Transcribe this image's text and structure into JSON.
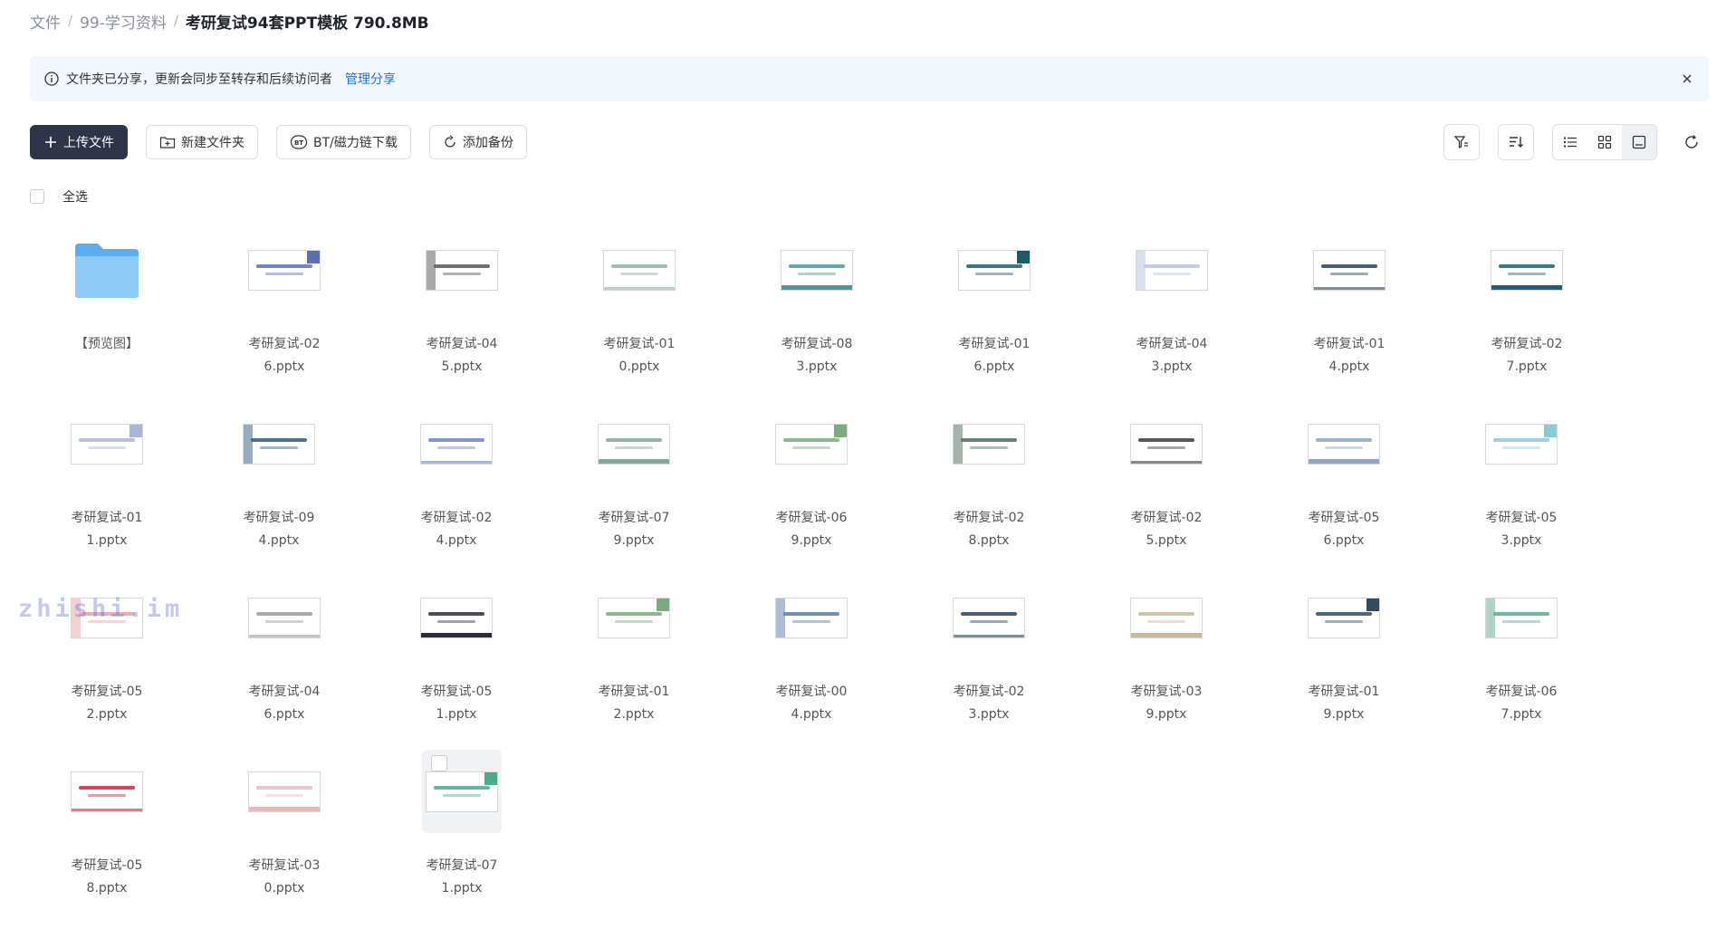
{
  "breadcrumb": {
    "items": [
      "文件",
      "99-学习资料"
    ],
    "current": "考研复试94套PPT模板 790.8MB",
    "separator": "/"
  },
  "notice": {
    "text": "文件夹已分享，更新会同步至转存和后续访问者",
    "link": "管理分享"
  },
  "toolbar": {
    "upload": "上传文件",
    "new_folder": "新建文件夹",
    "bt_download": "BT/磁力链下载",
    "add_backup": "添加备份"
  },
  "select_all": "全选",
  "files": [
    {
      "l1": "【预览图】",
      "l2": "",
      "type": "folder"
    },
    {
      "l1": "考研复试-02",
      "l2": "6.pptx",
      "accent": "#5b6fb3"
    },
    {
      "l1": "考研复试-04",
      "l2": "5.pptx",
      "accent": "#555555"
    },
    {
      "l1": "考研复试-01",
      "l2": "0.pptx",
      "accent": "#8fb3a8"
    },
    {
      "l1": "考研复试-08",
      "l2": "3.pptx",
      "accent": "#4a9a9a"
    },
    {
      "l1": "考研复试-01",
      "l2": "6.pptx",
      "accent": "#1d5a66"
    },
    {
      "l1": "考研复试-04",
      "l2": "3.pptx",
      "accent": "#b8c4da"
    },
    {
      "l1": "考研复试-01",
      "l2": "4.pptx",
      "accent": "#2c3e5a"
    },
    {
      "l1": "考研复试-02",
      "l2": "7.pptx",
      "accent": "#1f5f73"
    },
    {
      "l1": "考研复试-01",
      "l2": "1.pptx",
      "accent": "#aab6d8"
    },
    {
      "l1": "考研复试-09",
      "l2": "4.pptx",
      "accent": "#2c5a7a"
    },
    {
      "l1": "考研复试-02",
      "l2": "4.pptx",
      "accent": "#6d82c9"
    },
    {
      "l1": "考研复试-07",
      "l2": "9.pptx",
      "accent": "#7fa79a"
    },
    {
      "l1": "考研复试-06",
      "l2": "9.pptx",
      "accent": "#7cab7c"
    },
    {
      "l1": "考研复试-02",
      "l2": "8.pptx",
      "accent": "#4f6a5a"
    },
    {
      "l1": "考研复试-02",
      "l2": "5.pptx",
      "accent": "#3a3a3a"
    },
    {
      "l1": "考研复试-05",
      "l2": "6.pptx",
      "accent": "#8ea6c4"
    },
    {
      "l1": "考研复试-05",
      "l2": "3.pptx",
      "accent": "#8bcbd8"
    },
    {
      "l1": "考研复试-05",
      "l2": "2.pptx",
      "accent": "#e8a0a8"
    },
    {
      "l1": "考研复试-04",
      "l2": "6.pptx",
      "accent": "#9a9a9a"
    },
    {
      "l1": "考研复试-05",
      "l2": "1.pptx",
      "accent": "#2c2c3c"
    },
    {
      "l1": "考研复试-01",
      "l2": "2.pptx",
      "accent": "#7caa7c"
    },
    {
      "l1": "考研复试-00",
      "l2": "4.pptx",
      "accent": "#5c7aa3"
    },
    {
      "l1": "考研复试-02",
      "l2": "3.pptx",
      "accent": "#2c3e5a"
    },
    {
      "l1": "考研复试-03",
      "l2": "9.pptx",
      "accent": "#c9b89a"
    },
    {
      "l1": "考研复试-01",
      "l2": "9.pptx",
      "accent": "#34495e"
    },
    {
      "l1": "考研复试-06",
      "l2": "7.pptx",
      "accent": "#5aab8a"
    },
    {
      "l1": "考研复试-05",
      "l2": "8.pptx",
      "accent": "#c8233a"
    },
    {
      "l1": "考研复试-03",
      "l2": "0.pptx",
      "accent": "#e8b8c0"
    },
    {
      "l1": "考研复试-07",
      "l2": "1.pptx",
      "accent": "#4aaa8a"
    }
  ],
  "watermark": "zhishi.im"
}
